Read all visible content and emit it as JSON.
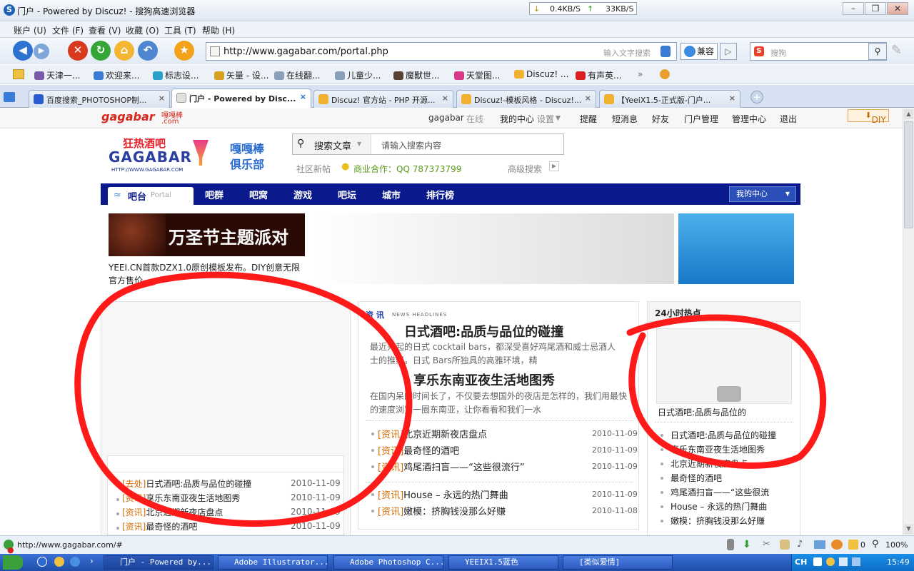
{
  "window": {
    "title": "门户 - Powered by Discuz! - 搜狗高速浏览器",
    "download_speed": "0.4KB/S",
    "upload_speed": "33KB/S"
  },
  "menu": [
    "账户 (U)",
    "文件 (F)",
    "查看 (V)",
    "收藏 (O)",
    "工具 (T)",
    "帮助 (H)"
  ],
  "address": {
    "url": "http://www.gagabar.com/portal.php",
    "hint": "输入文字搜索",
    "compat": "兼容",
    "search_placeholder": "搜狗"
  },
  "favorites": [
    "天津一...",
    "欢迎来...",
    "标志设...",
    "矢量 - 设...",
    "在线翻...",
    "儿童少...",
    "魔獸世...",
    "天堂图...",
    "Discuz! ...",
    "有声英..."
  ],
  "tabs": [
    {
      "label": "百度搜索_PHOTOSHOP制...",
      "active": false
    },
    {
      "label": "门户 - Powered by Disc...",
      "active": true
    },
    {
      "label": "Discuz! 官方站 - PHP 开源...",
      "active": false
    },
    {
      "label": "Discuz!-模板风格 - Discuz!...",
      "active": false
    },
    {
      "label": "【YeeiX1.5-正式版-门户...",
      "active": false
    }
  ],
  "site": {
    "brand": "gagabar",
    "brand_sub": "嘎嘎棒",
    "brand_com": ".com",
    "user": "gagabar",
    "online": "在线",
    "my_center": "我的中心",
    "settings": "设置",
    "links": [
      "提醒",
      "短消息",
      "好友",
      "门户管理",
      "管理中心",
      "退出"
    ],
    "diy": "DIY",
    "logo_text": "狂热酒吧",
    "logo_word": "GAGABAR",
    "logo_url": "HTTP://WWW.GAGABAR.COM",
    "club_line1": "嘎嘎棒",
    "club_line2": "俱乐部",
    "search_type": "搜索文章",
    "search_placeholder": "请输入搜索内容",
    "new_post": "社区新帖",
    "business": "商业合作：QQ 787373799",
    "advanced": "高级搜索"
  },
  "nav": {
    "current": "吧台",
    "current_sub": "Portal",
    "items": [
      "吧群",
      "吧窝",
      "游戏",
      "吧坛",
      "城市",
      "排行榜"
    ],
    "my_center": "我的中心"
  },
  "banner": {
    "party_title": "万圣节主题派对",
    "yeei_line1": "YEEI.CN首款DZX1.0原创模板发布。DIY创意无限",
    "yeei_line2": "官方售价"
  },
  "left_list": [
    {
      "tag": "[去处]",
      "title": "日式酒吧:品质与品位的碰撞",
      "date": "2010-11-09"
    },
    {
      "tag": "[资讯]",
      "title": "享乐东南亚夜生活地图秀",
      "date": "2010-11-09"
    },
    {
      "tag": "[资讯]",
      "title": "北京近期新夜店盘点",
      "date": "2010-11-09"
    },
    {
      "tag": "[资讯]",
      "title": "最奇怪的酒吧",
      "date": "2010-11-09"
    }
  ],
  "center": {
    "section": "资 讯",
    "news_label": "NEWS HEADLINES",
    "headline1": "日式酒吧:品质与品位的碰撞",
    "summary1_a": "最近兴起的日式  cocktail bars，都深受喜好鸡尾酒和威士忌酒人",
    "summary1_b": "士的推崇。日式 Bars所独具的高雅环境，精",
    "headline2": "享乐东南亚夜生活地图秀",
    "summary2_a": "在国内呆的时间长了，不仅要去想国外的夜店是怎样的，我们用最快",
    "summary2_b": "的速度浏览一圈东南亚，让你看看和我们一水",
    "list": [
      {
        "tag": "[资讯]",
        "title": "北京近期新夜店盘点",
        "date": "2010-11-09"
      },
      {
        "tag": "[资讯]",
        "title": "最奇怪的酒吧",
        "date": "2010-11-09"
      },
      {
        "tag": "[资讯]",
        "title": "鸡尾酒扫盲——“这些很流行”",
        "date": "2010-11-09"
      },
      {
        "tag": "[资讯]",
        "title": "House – 永远的热门舞曲",
        "date": "2010-11-09"
      },
      {
        "tag": "[资讯]",
        "title": "嫩模：挤胸钱没那么好赚",
        "date": "2010-11-08"
      }
    ]
  },
  "right": {
    "header": "24小时热点",
    "caption": "日式酒吧:品质与品位的",
    "list": [
      "日式酒吧:品质与品位的碰撞",
      "享乐东南亚夜生活地图秀",
      "北京近期新夜店盘点",
      "最奇怪的酒吧",
      "鸡尾酒扫盲——“这些很流",
      "House – 永远的热门舞曲",
      "嫩模：挤胸钱没那么好赚"
    ]
  },
  "status": {
    "url": "http://www.gagabar.com/#",
    "count": "0",
    "zoom": "100%"
  },
  "taskbar": {
    "tasks": [
      "门户 - Powered by...",
      "Adobe Illustrator...",
      "Adobe Photoshop C...",
      "YEEIX1.5蓝色",
      "[类似爱情]"
    ],
    "ime": "CH",
    "time": "15:49"
  },
  "colors": {
    "nav_bg": "#0a1a8c",
    "tag": "#d46b00",
    "annotation": "#ff1a1a"
  }
}
